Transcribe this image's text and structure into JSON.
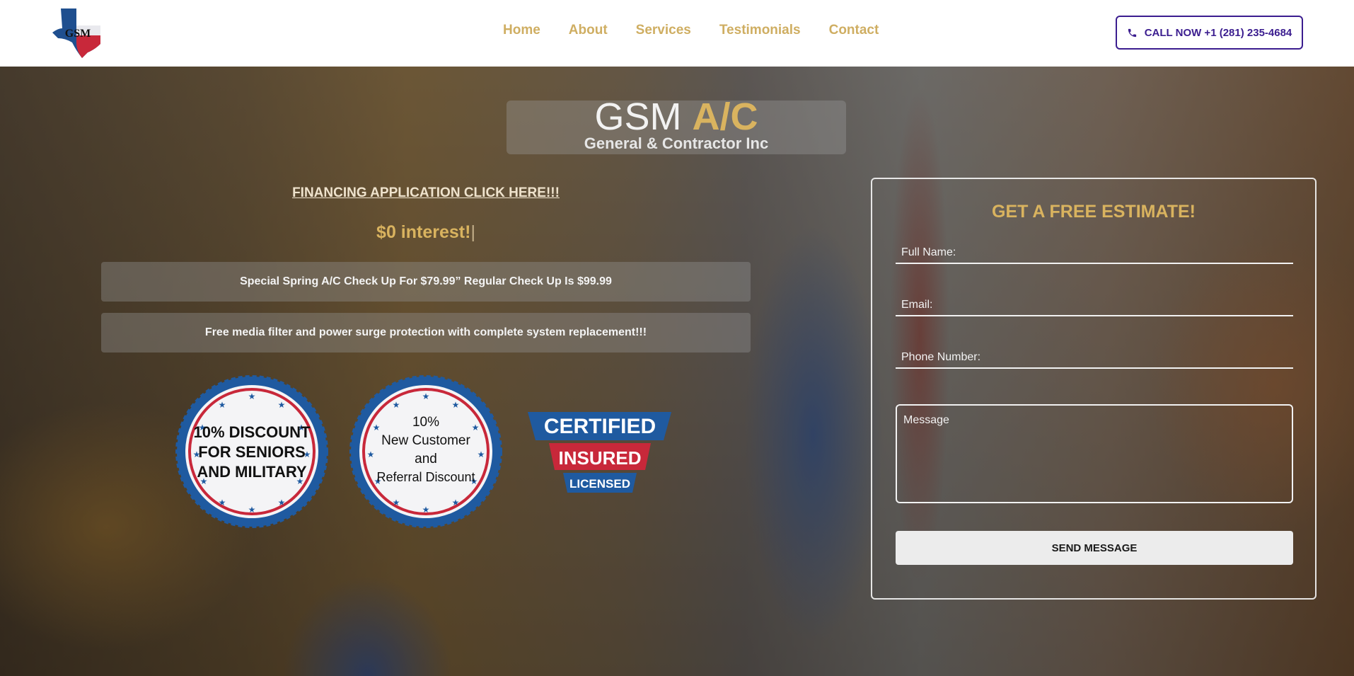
{
  "header": {
    "logo_text": "GSM",
    "nav": [
      "Home",
      "About",
      "Services",
      "Testimonials",
      "Contact"
    ],
    "call_button": "CALL NOW +1 (281) 235-4684",
    "call_icon": "phone-icon"
  },
  "hero": {
    "brand_white": "GSM",
    "brand_gold": "A/C",
    "brand_sub": "General & Contractor Inc",
    "financing_link": "FINANCING APPLICATION CLICK HERE!!!",
    "interest": "$0 interest!",
    "interest_caret": "|",
    "promos": [
      "Special Spring A/C Check Up For $79.99” Regular Check Up Is $99.99",
      "Free media filter and power surge protection with complete system replacement!!!"
    ],
    "badges": {
      "seniors": [
        "10% DISCOUNT",
        "FOR SENIORS",
        "AND MILITARY"
      ],
      "new_customer": [
        "10%",
        "New Customer",
        "and",
        "Referral Discount"
      ],
      "certified": [
        "CERTIFIED",
        "INSURED",
        "LICENSED"
      ]
    }
  },
  "form": {
    "title": "GET A FREE ESTIMATE!",
    "full_name_placeholder": "Full Name:",
    "email_placeholder": "Email:",
    "phone_placeholder": "Phone Number:",
    "message_placeholder": "Message",
    "send_label": "SEND MESSAGE"
  },
  "colors": {
    "gold": "#d9b35f",
    "nav_gold": "#cfae62",
    "purple": "#3b1d8f",
    "badge_blue": "#1f5aa0",
    "badge_red": "#c8283a"
  }
}
